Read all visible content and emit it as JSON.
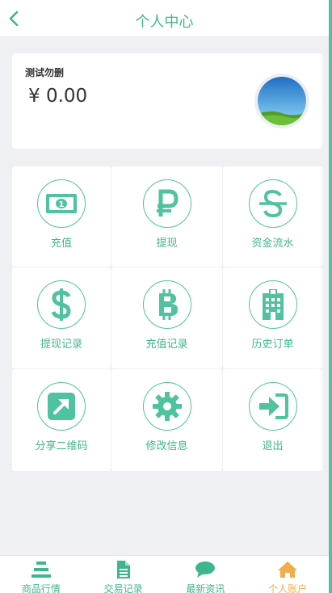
{
  "header": {
    "title": "个人中心",
    "back_icon": "chevron-left-icon"
  },
  "account": {
    "name": "测试勿删",
    "balance": "¥ 0.00"
  },
  "menu": [
    {
      "label": "充值",
      "icon": "banknote-icon"
    },
    {
      "label": "提现",
      "icon": "ruble-icon"
    },
    {
      "label": "资金流水",
      "icon": "currency-s-icon"
    },
    {
      "label": "提现记录",
      "icon": "dollar-icon"
    },
    {
      "label": "充值记录",
      "icon": "bitcoin-icon"
    },
    {
      "label": "历史订单",
      "icon": "building-icon"
    },
    {
      "label": "分享二维码",
      "icon": "share-arrow-icon"
    },
    {
      "label": "修改信息",
      "icon": "gear-icon"
    },
    {
      "label": "退出",
      "icon": "sign-in-icon"
    }
  ],
  "tabs": [
    {
      "label": "商品行情",
      "icon": "bars-icon"
    },
    {
      "label": "交易记录",
      "icon": "document-icon"
    },
    {
      "label": "最新资讯",
      "icon": "chat-icon"
    },
    {
      "label": "个人账户",
      "icon": "home-icon",
      "active": true
    }
  ],
  "colors": {
    "accent": "#3fb58f",
    "active_tab": "#f0ad4e",
    "background": "#eef0f3"
  }
}
